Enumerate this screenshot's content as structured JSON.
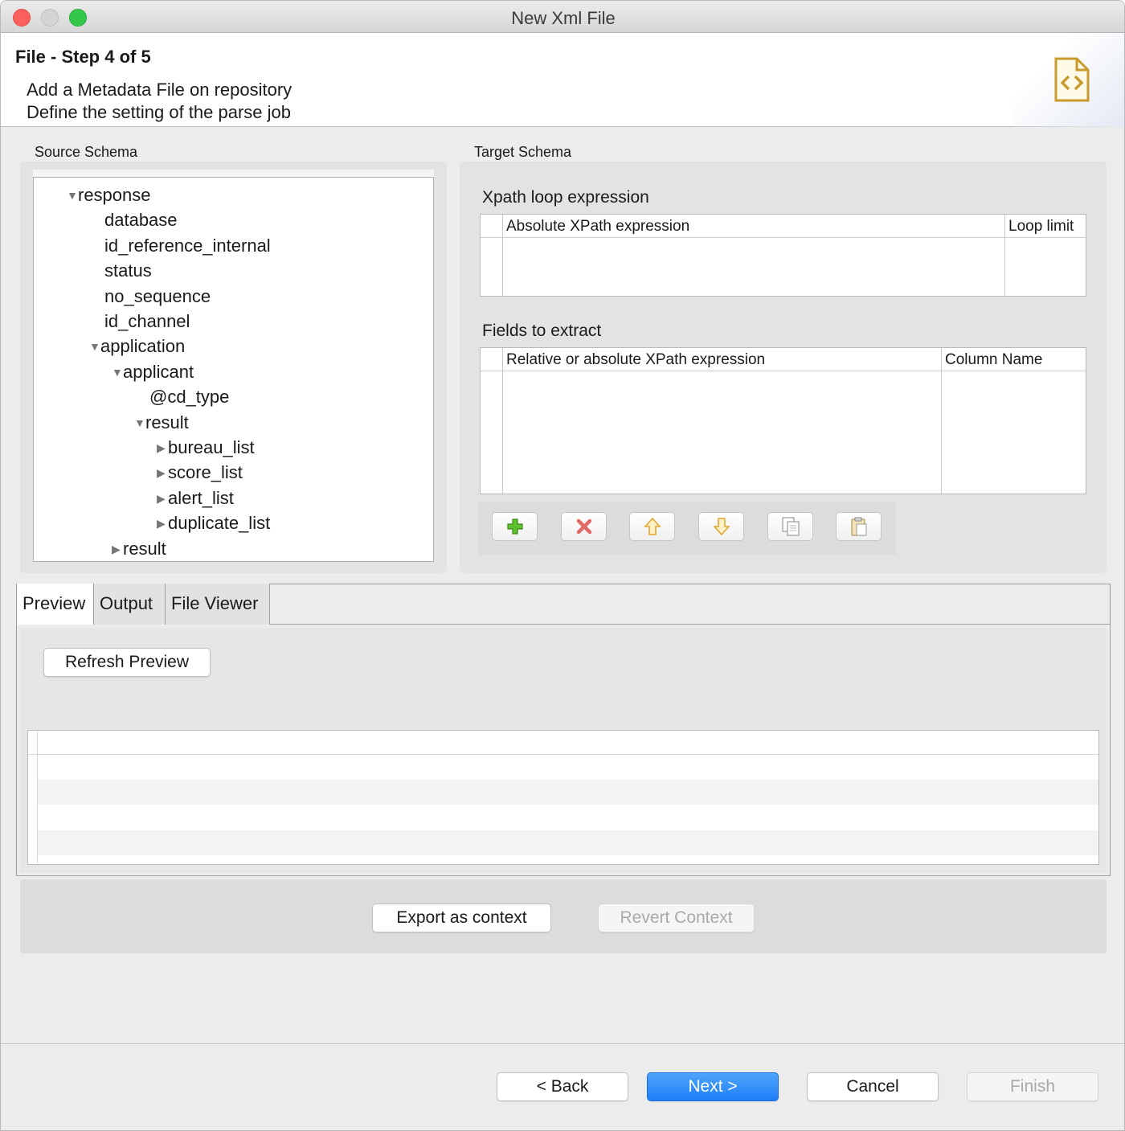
{
  "window": {
    "title": "New Xml File"
  },
  "header": {
    "step_title": "File - Step 4 of 5",
    "description_line1": "Add a Metadata File on repository",
    "description_line2": "Define the setting of the parse job",
    "icon": "xml-file-icon"
  },
  "source_schema": {
    "label": "Source Schema",
    "tree": [
      {
        "label": "response",
        "expanded": true
      },
      {
        "label": "database"
      },
      {
        "label": "id_reference_internal"
      },
      {
        "label": "status"
      },
      {
        "label": "no_sequence"
      },
      {
        "label": "id_channel"
      },
      {
        "label": "application",
        "expanded": true
      },
      {
        "label": "applicant",
        "expanded": true
      },
      {
        "label": "@cd_type"
      },
      {
        "label": "result",
        "expanded": true
      },
      {
        "label": "bureau_list",
        "expanded": false
      },
      {
        "label": "score_list",
        "expanded": false
      },
      {
        "label": "alert_list",
        "expanded": false
      },
      {
        "label": "duplicate_list",
        "expanded": false
      },
      {
        "label": "result",
        "expanded": false
      }
    ]
  },
  "target_schema": {
    "label": "Target Schema",
    "xpath_loop": {
      "label": "Xpath loop expression",
      "columns": [
        "Absolute XPath expression",
        "Loop limit"
      ]
    },
    "fields": {
      "label": "Fields to extract",
      "columns": [
        "Relative or absolute XPath expression",
        "Column Name"
      ]
    },
    "toolbar_icons": [
      "add-icon",
      "remove-icon",
      "move-up-icon",
      "move-down-icon",
      "copy-icon",
      "paste-icon"
    ]
  },
  "tabs": [
    {
      "label": "Preview",
      "active": true
    },
    {
      "label": "Output",
      "active": false
    },
    {
      "label": "File Viewer",
      "active": false
    }
  ],
  "preview": {
    "refresh_label": "Refresh Preview"
  },
  "context": {
    "export_label": "Export as context",
    "revert_label": "Revert Context"
  },
  "footer": {
    "back_label": "< Back",
    "next_label": "Next >",
    "cancel_label": "Cancel",
    "finish_label": "Finish"
  },
  "colors": {
    "accent": "#1e7ef7",
    "close": "#fc605c",
    "maximize": "#34c84a",
    "add_icon": "#4caf24",
    "remove_icon": "#e0443e",
    "arrow_icon": "#e0a830"
  }
}
